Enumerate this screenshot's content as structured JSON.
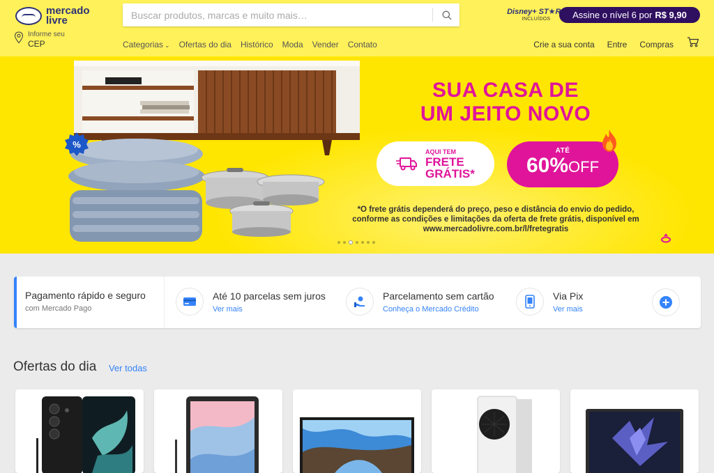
{
  "header": {
    "logo_line1": "mercado",
    "logo_line2": "livre",
    "search_placeholder": "Buscar produtos, marcas e muito mais…",
    "disney_logo": "Disney+ ST★R+",
    "disney_sub": "INCLUÍDOS",
    "subscribe_label": "Assine o nível 6 por",
    "subscribe_price": "R$ 9,90",
    "cep_small": "Informe seu",
    "cep_big": "CEP",
    "nav": [
      "Categorias",
      "Ofertas do dia",
      "Histórico",
      "Moda",
      "Vender",
      "Contato"
    ],
    "user_nav": [
      "Crie a sua conta",
      "Entre",
      "Compras"
    ]
  },
  "banner": {
    "headline_line1": "SUA CASA DE",
    "headline_line2_a": "UM ",
    "headline_line2_b": "JEITO NOVO",
    "frete_small": "AQUI TEM",
    "frete_line1": "FRETE",
    "frete_line2": "GRÁTIS*",
    "off_small": "ATÉ",
    "off_value": "60%",
    "off_label": "OFF",
    "disclaimer": "*O frete grátis dependerá do preço, peso e distância do envio do pedido, conforme as condições e limitações da oferta de frete grátis, disponível em www.mercadolivre.com.br/l/fretegratis",
    "badge": "%"
  },
  "payments": [
    {
      "title": "Pagamento rápido e seguro",
      "sub": "com Mercado Pago"
    },
    {
      "title": "Até 10 parcelas sem juros",
      "link": "Ver mais",
      "icon": "card-icon"
    },
    {
      "title": "Parcelamento sem cartão",
      "link": "Conheça o Mercado Crédito",
      "icon": "hand-coin-icon"
    },
    {
      "title": "Via Pix",
      "link": "Ver mais",
      "icon": "phone-pix-icon"
    }
  ],
  "offers": {
    "title": "Ofertas do dia",
    "link": "Ver todas",
    "cards": [
      "smartphone",
      "tablet",
      "tv",
      "console",
      "notebook"
    ]
  },
  "colors": {
    "header_bg": "#fff159",
    "banner_bg": "#ffe600",
    "accent_pink": "#e0149a",
    "link_blue": "#3483fa",
    "subscribe_bg": "#2f0f60"
  }
}
